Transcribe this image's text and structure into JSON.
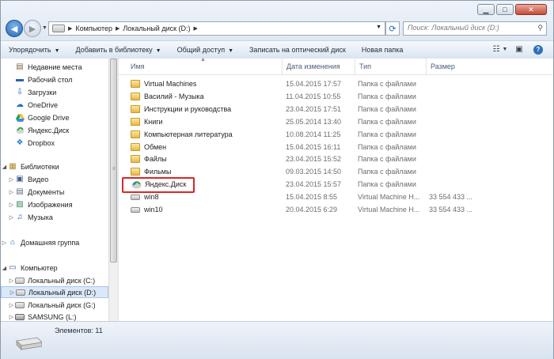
{
  "navigation": {
    "breadcrumb": [
      "Компьютер",
      "Локальный диск (D:)"
    ],
    "search_placeholder": "Поиск: Локальный диск (D:)"
  },
  "toolbar": {
    "organize": "Упорядочить",
    "add_to_library": "Добавить в библиотеку",
    "share": "Общий доступ",
    "burn": "Записать на оптический диск",
    "new_folder": "Новая папка"
  },
  "sidebar": {
    "favorites": [
      {
        "label": "Недавние места",
        "icon": "recent-places-icon"
      },
      {
        "label": "Рабочий стол",
        "icon": "desktop-icon"
      },
      {
        "label": "Загрузки",
        "icon": "downloads-icon"
      },
      {
        "label": "OneDrive",
        "icon": "onedrive-icon"
      },
      {
        "label": "Google Drive",
        "icon": "google-drive-icon"
      },
      {
        "label": "Яндекс.Диск",
        "icon": "yandex-disk-icon"
      },
      {
        "label": "Dropbox",
        "icon": "dropbox-icon"
      }
    ],
    "libraries_label": "Библиотеки",
    "libraries": [
      {
        "label": "Видео",
        "icon": "video-library-icon"
      },
      {
        "label": "Документы",
        "icon": "documents-library-icon"
      },
      {
        "label": "Изображения",
        "icon": "pictures-library-icon"
      },
      {
        "label": "Музыка",
        "icon": "music-library-icon"
      }
    ],
    "homegroup_label": "Домашняя группа",
    "computer_label": "Компьютер",
    "drives": [
      {
        "label": "Локальный диск (C:)",
        "selected": false
      },
      {
        "label": "Локальный диск (D:)",
        "selected": true
      },
      {
        "label": "Локальный диск (G:)",
        "selected": false
      },
      {
        "label": "SAMSUNG (L:)",
        "selected": false
      }
    ]
  },
  "columns": {
    "name": "Имя",
    "date": "Дата изменения",
    "type": "Тип",
    "size": "Размер"
  },
  "files": [
    {
      "name": "Virtual Machines",
      "date": "15.04.2015 17:57",
      "type": "Папка с файлами",
      "size": "",
      "kind": "folder"
    },
    {
      "name": "Василий - Музыка",
      "date": "11.04.2015 10:55",
      "type": "Папка с файлами",
      "size": "",
      "kind": "folder"
    },
    {
      "name": "Инструкции и руководства",
      "date": "23.04.2015 17:51",
      "type": "Папка с файлами",
      "size": "",
      "kind": "folder"
    },
    {
      "name": "Книги",
      "date": "25.05.2014 13:40",
      "type": "Папка с файлами",
      "size": "",
      "kind": "folder"
    },
    {
      "name": "Компьютерная литература",
      "date": "10.08.2014 11:25",
      "type": "Папка с файлами",
      "size": "",
      "kind": "folder"
    },
    {
      "name": "Обмен",
      "date": "15.04.2015 16:11",
      "type": "Папка с файлами",
      "size": "",
      "kind": "folder"
    },
    {
      "name": "Файлы",
      "date": "23.04.2015 15:52",
      "type": "Папка с файлами",
      "size": "",
      "kind": "folder"
    },
    {
      "name": "Фильмы",
      "date": "09.03.2015 14:50",
      "type": "Папка с файлами",
      "size": "",
      "kind": "folder"
    },
    {
      "name": "Яндекс.Диск",
      "date": "23.04.2015 15:57",
      "type": "Папка с файлами",
      "size": "",
      "kind": "yandex"
    },
    {
      "name": "win8",
      "date": "15.04.2015 8:55",
      "type": "Virtual Machine H...",
      "size": "33 554 433 ...",
      "kind": "vm"
    },
    {
      "name": "win10",
      "date": "20.04.2015 6:29",
      "type": "Virtual Machine H...",
      "size": "33 554 433 ...",
      "kind": "vm"
    }
  ],
  "status": {
    "items_count": "Элементов: 11"
  },
  "colors": {
    "highlight": "#d9262a",
    "selected_bg": "#dbe8f7"
  }
}
